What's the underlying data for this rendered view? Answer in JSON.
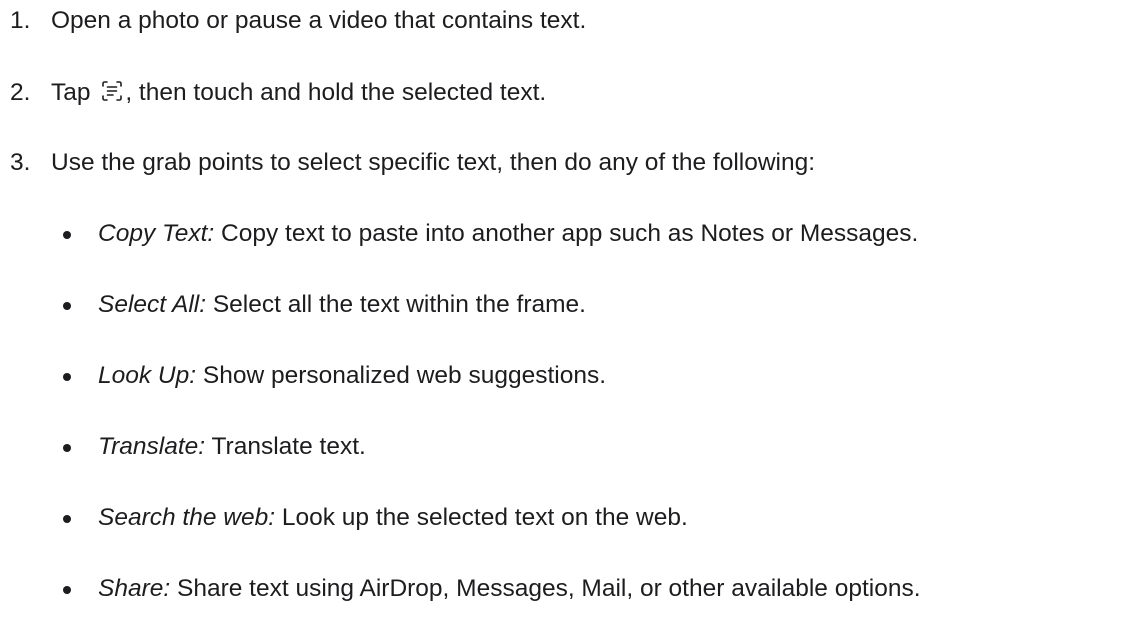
{
  "steps": [
    {
      "number": "1.",
      "text": "Open a photo or pause a video that contains text."
    },
    {
      "number": "2.",
      "text_before": "Tap ",
      "icon": "live-text-scan-icon",
      "text_after": ", then touch and hold the selected text."
    },
    {
      "number": "3.",
      "text": "Use the grab points to select specific text, then do any of the following:"
    }
  ],
  "options": [
    {
      "term": "Copy Text:",
      "description": " Copy text to paste into another app such as Notes or Messages."
    },
    {
      "term": "Select All:",
      "description": " Select all the text within the frame."
    },
    {
      "term": "Look Up:",
      "description": " Show personalized web suggestions."
    },
    {
      "term": "Translate:",
      "description": " Translate text."
    },
    {
      "term": "Search the web:",
      "description": " Look up the selected text on the web."
    },
    {
      "term": "Share:",
      "description": " Share text using AirDrop, Messages, Mail, or other available options."
    }
  ]
}
